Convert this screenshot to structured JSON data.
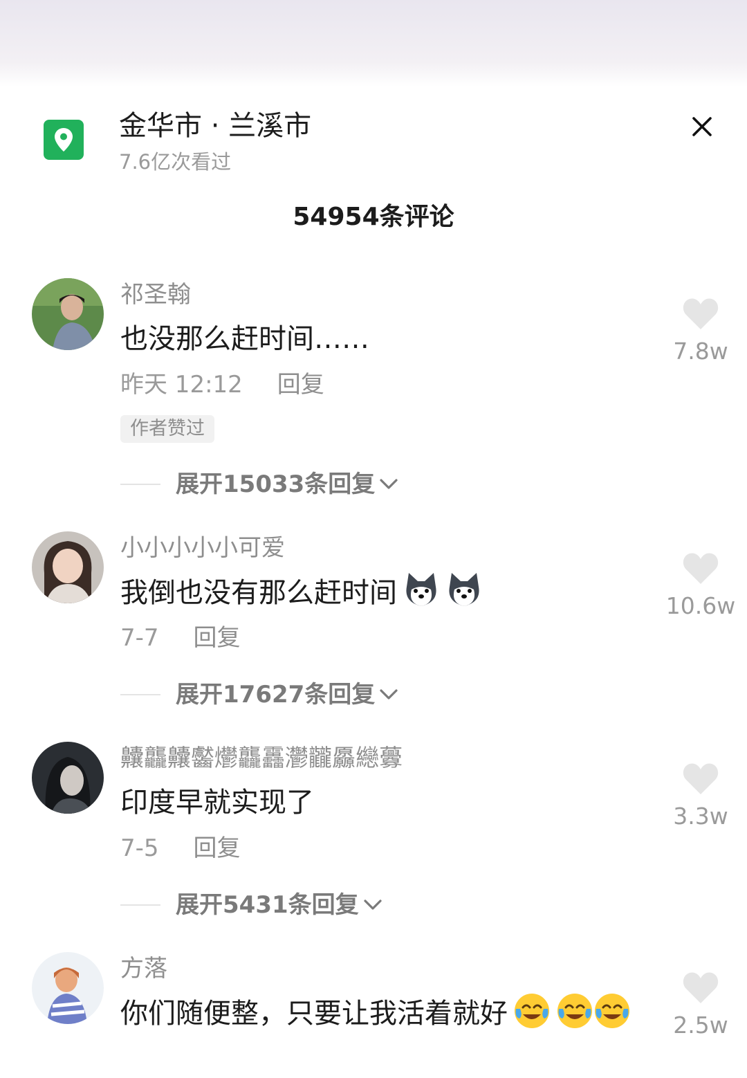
{
  "header": {
    "location_title": "金华市 · 兰溪市",
    "views": "7.6亿次看过",
    "comment_count_title": "54954条评论"
  },
  "colors": {
    "location_icon": "#21b15b",
    "heart": "#e5e5e5"
  },
  "comments": [
    {
      "username": "祁圣翰",
      "text": "也没那么赶时间……",
      "time": "昨天 12:12",
      "reply_label": "回复",
      "badge": "作者赞过",
      "expand": "展开15033条回复",
      "likes": "7.8w"
    },
    {
      "username": "小小小小小可爱",
      "text": "我倒也没有那么赶时间",
      "emojis": [
        "husky-emoji",
        "husky-emoji"
      ],
      "time": "7-7",
      "reply_label": "回复",
      "expand": "展开17627条回复",
      "likes": "10.6w"
    },
    {
      "username": "齉龘齉齾爩龘靐灪龖厵纞虋",
      "text": "印度早就实现了",
      "time": "7-5",
      "reply_label": "回复",
      "expand": "展开5431条回复",
      "likes": "3.3w"
    },
    {
      "username": "方落",
      "text": "你们随便整，只要让我活着就好",
      "emojis": [
        "crying-laughing-emoji",
        "crying-laughing-emoji",
        "crying-laughing-emoji"
      ],
      "likes": "2.5w"
    }
  ]
}
